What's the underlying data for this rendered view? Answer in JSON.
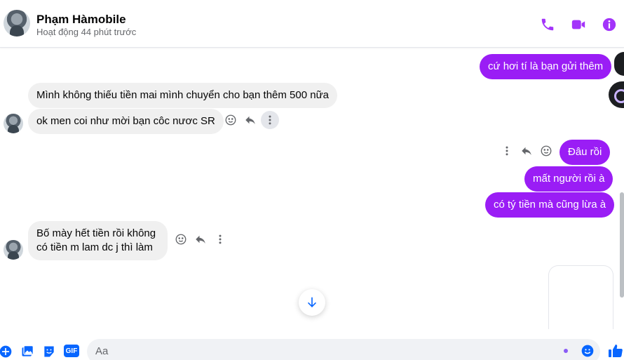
{
  "header": {
    "contact_name": "Phạm Hàmobile",
    "status": "Hoạt động 44 phút trước",
    "actions": [
      "phone-icon",
      "video-icon",
      "info-icon"
    ],
    "accent_color": "#a334fa"
  },
  "messages": [
    {
      "id": "m1",
      "side": "out",
      "text": "cứ hơi tí là bạn gửi thêm"
    },
    {
      "id": "m2",
      "side": "in",
      "text": "Mình không thiếu tiền mai mình chuyển cho bạn thêm 500 nữa"
    },
    {
      "id": "m3",
      "side": "in",
      "text": "ok men coi như mời bạn côc nươc SR"
    },
    {
      "id": "m4",
      "side": "out",
      "text": "Đâu rồi"
    },
    {
      "id": "m5",
      "side": "out",
      "text": "mất người rồi à"
    },
    {
      "id": "m6",
      "side": "out",
      "text": "có tý tiền mà cũng lừa à"
    },
    {
      "id": "m7",
      "side": "in",
      "lines": [
        "Bố mày hết tiền rồi không",
        "có tiền m lam dc j thì làm"
      ]
    }
  ],
  "message_actions": [
    "react-icon",
    "reply-icon",
    "more-icon"
  ],
  "composer": {
    "placeholder": "Aa",
    "tools": [
      "add-icon",
      "photo-icon",
      "sticker-icon",
      "gif-icon"
    ],
    "gif_label": "GIF"
  },
  "colors": {
    "outgoing_bubble": "#9a1df5",
    "incoming_bubble": "#f0f0f0",
    "composer_icons": "#0866ff"
  }
}
